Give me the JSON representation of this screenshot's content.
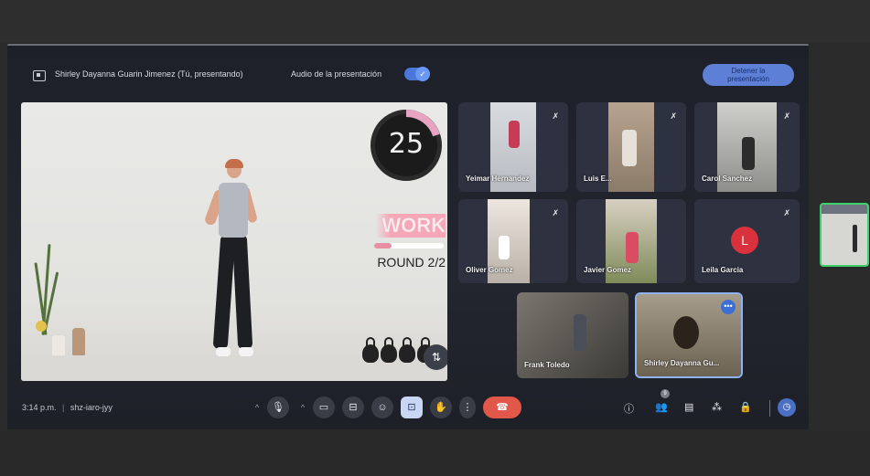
{
  "header": {
    "presenter_label": "Shirley Dayanna Guarin Jimenez (Tú, presentando)",
    "audio_label": "Audio de la presentación",
    "audio_toggle_on": true,
    "stop_button": "Detener la presentación"
  },
  "presentation": {
    "timer_value": "25",
    "work_label": "WORK",
    "work_progress": 0.25,
    "round_label": "ROUND 2/2"
  },
  "participants": [
    {
      "name": "Yeimar Hernandez",
      "muted": true
    },
    {
      "name": "Luis E...",
      "muted": true
    },
    {
      "name": "Carol Sanchez",
      "muted": true
    },
    {
      "name": "Oliver Gomez",
      "muted": true
    },
    {
      "name": "Javier Gomez",
      "muted": false
    },
    {
      "name": "Leila Garcia",
      "muted": true,
      "avatar_letter": "L"
    },
    {
      "name": "Frank Toledo",
      "muted": false
    },
    {
      "name": "Shirley Dayanna Gu...",
      "muted": false
    }
  ],
  "footer": {
    "time": "3:14 p.m.",
    "separator": "|",
    "meeting_code": "shz-iaro-jyy",
    "people_count": "9"
  },
  "colors": {
    "accent": "#5d7fd6",
    "end_call": "#e1584a",
    "active_speaker_border": "#3ed16a",
    "avatar": "#d9323d"
  },
  "icons": {
    "present": "present-icon",
    "mic": "mic-icon",
    "camera": "camera-icon",
    "captions": "captions-icon",
    "emoji": "emoji-icon",
    "present_now": "present-screen-icon",
    "hand": "raise-hand-icon",
    "more": "more-vert-icon",
    "end": "end-call-icon",
    "info": "info-icon",
    "people": "people-icon",
    "chat": "chat-icon",
    "activities": "activities-icon",
    "lock": "lock-icon",
    "timer": "timer-icon"
  }
}
